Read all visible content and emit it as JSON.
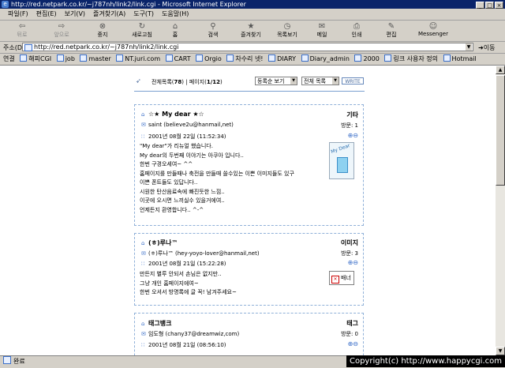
{
  "window": {
    "title": "http://red.netpark.co.kr/~j787nh/link2/link.cgi - Microsoft Internet Explorer"
  },
  "menu": [
    "파일(F)",
    "편집(E)",
    "보기(V)",
    "즐겨찾기(A)",
    "도구(T)",
    "도움말(H)"
  ],
  "toolbar": [
    {
      "label": "뒤로",
      "icon": "back-arrow-icon",
      "glyph": "⇦",
      "disabled": true
    },
    {
      "label": "앞으로",
      "icon": "forward-arrow-icon",
      "glyph": "⇨",
      "disabled": true
    },
    {
      "label": "중지",
      "icon": "stop-icon",
      "glyph": "⊗",
      "disabled": false
    },
    {
      "label": "새로고침",
      "icon": "refresh-icon",
      "glyph": "↻",
      "disabled": false
    },
    {
      "label": "홈",
      "icon": "home-icon",
      "glyph": "⌂",
      "disabled": false
    },
    {
      "label": "검색",
      "icon": "search-icon",
      "glyph": "⚲",
      "disabled": false
    },
    {
      "label": "즐겨찾기",
      "icon": "favorites-icon",
      "glyph": "★",
      "disabled": false
    },
    {
      "label": "목록보기",
      "icon": "history-icon",
      "glyph": "◷",
      "disabled": false
    },
    {
      "label": "메일",
      "icon": "mail-icon",
      "glyph": "✉",
      "disabled": false
    },
    {
      "label": "인쇄",
      "icon": "print-icon",
      "glyph": "⎙",
      "disabled": false
    },
    {
      "label": "편집",
      "icon": "edit-icon",
      "glyph": "✎",
      "disabled": false
    },
    {
      "label": "Messenger",
      "icon": "messenger-icon",
      "glyph": "☺",
      "disabled": false
    }
  ],
  "address": {
    "label": "주소(D)",
    "url": "http://red.netpark.co.kr/~j787nh/link2/link.cgi",
    "go_label": "이동"
  },
  "links": {
    "label": "연결",
    "items": [
      "해피CGI",
      "job",
      "master",
      "NT.juri.com",
      "CART",
      "Orgio",
      "차수리 넷!",
      "DIARY",
      "Diary_admin",
      "2000",
      "링크 사용자 정의",
      "Hotmail"
    ]
  },
  "guestbook": {
    "summary_prefix": "전체목록(",
    "total": "78",
    "summary_mid": ") | 페이지(",
    "page": "1/12",
    "summary_suffix": ")",
    "sort_select": "등록순 보기",
    "filter_select": "전체 목록",
    "write_button": "WRITE",
    "entries": [
      {
        "name": "☆★ My dear ★☆",
        "category": "기타",
        "email": "saint (believe2u@hanmail,net)",
        "views_label": "방문: 1",
        "date": "2001년 08월 22일 (11:52:34)",
        "lines": [
          "\"My dear\"가 리뉴얼 했습니다.",
          "My dear의 두번째 이야기는 아쿠아 입니다..",
          "한번 구경오세여~ ^^",
          "홈페이지를 만들때나 축전을 만들때 쓸수있는 이쁜 이미지들도 있구",
          "이쁜 폰트들도 있답니다..",
          "시원한 탄산음료속에 빠진듯한 느낌..",
          "이곳에 오시면 느끼실수 있을거에여..",
          "언제든지 환영합니다.. ^-^"
        ],
        "thumb": "My Dear"
      },
      {
        "name": "(ㅎ)루나™",
        "category": "이미지",
        "email": "(ㅎ)루나™ (hey-yoyo-lover@hanmail,net)",
        "views_label": "방문: 3",
        "date": "2001년 08월 21일 (15:22:28)",
        "lines": [
          "만든지 별루 안되서 손님은 없지만..",
          "그냥 개인 홈페이지에여~",
          "한번 오셔서 방명록에 글 꼭! 남겨주세요~"
        ],
        "thumb": "배너"
      },
      {
        "name": "태그뱅크",
        "category": "태그",
        "email": "임도형 (chany37@dreamwiz,com)",
        "views_label": "방문: 0",
        "date": "2001년 08월 21일 (08:56:10)",
        "lines": [],
        "thumb": ""
      }
    ]
  },
  "status": {
    "text": "완료",
    "copyright": "Copyright(c) http://www.happycgi.com"
  }
}
